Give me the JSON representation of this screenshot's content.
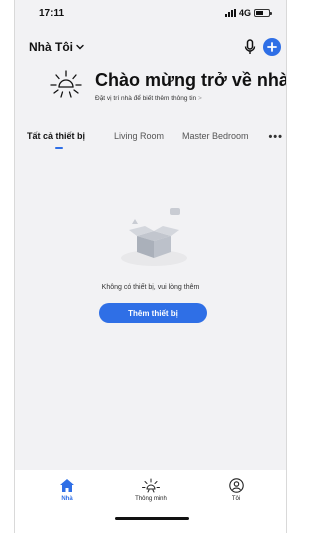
{
  "status_bar": {
    "time": "17:11",
    "network": "4G"
  },
  "header": {
    "home_name": "Nhà Tôi",
    "welcome_title": "Chào mừng trở về nhà",
    "welcome_subtitle": "Đặt vị trí nhà để biết thêm thông tin",
    "welcome_subtitle_chevron": ">"
  },
  "tabs": [
    {
      "label": "Tất cả thiết bị",
      "active": true
    },
    {
      "label": "Living Room",
      "active": false
    },
    {
      "label": "Master Bedroom",
      "active": false
    }
  ],
  "more_label": "•••",
  "empty_state": {
    "message": "Không có thiết bị, vui lòng thêm",
    "button_label": "Thêm thiết bị"
  },
  "bottom_nav": [
    {
      "label": "Nhà",
      "icon": "home-icon",
      "active": true
    },
    {
      "label": "Thông minh",
      "icon": "smart-sun-icon",
      "active": false
    },
    {
      "label": "Tôi",
      "icon": "profile-icon",
      "active": false
    }
  ],
  "colors": {
    "accent": "#2f6fe6",
    "background": "#f2f2f4"
  }
}
